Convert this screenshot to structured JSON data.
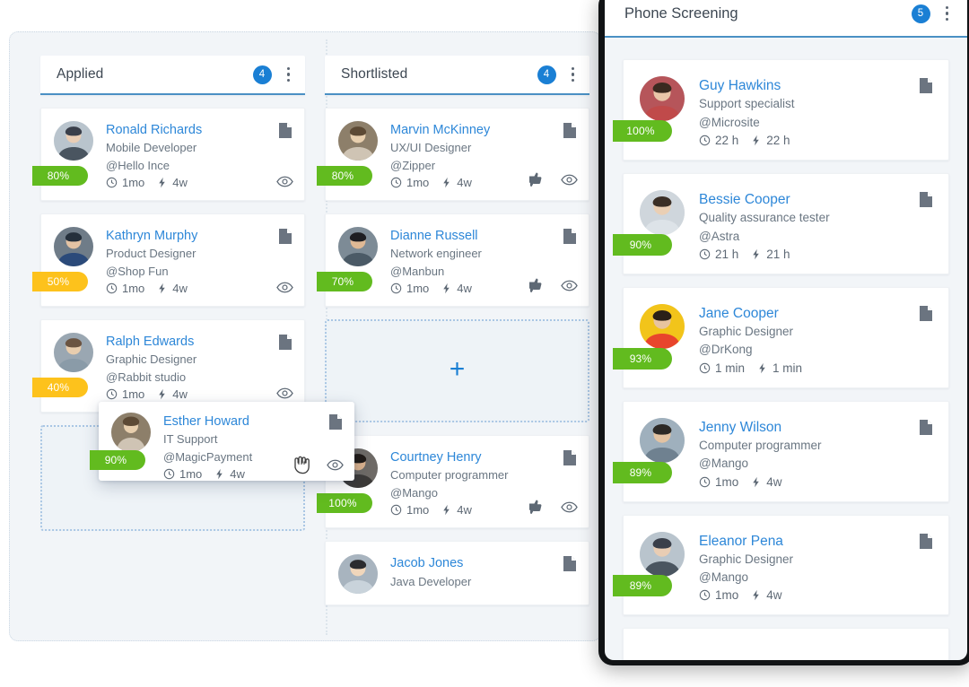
{
  "board": {
    "columns": [
      {
        "title": "Applied",
        "count": "4",
        "cards": [
          {
            "name": "Ronald Richards",
            "role": "Mobile Developer",
            "company": "@Hello Ince",
            "time": "1mo",
            "bolt": "4w",
            "pct": "80%",
            "pct_color": "#62bb1f",
            "actions": [
              "eye-icon"
            ]
          },
          {
            "name": "Kathryn Murphy",
            "role": "Product Designer",
            "company": "@Shop Fun",
            "time": "1mo",
            "bolt": "4w",
            "pct": "50%",
            "pct_color": "#fdc21c",
            "actions": [
              "eye-icon"
            ]
          },
          {
            "name": "Ralph Edwards",
            "role": "Graphic Designer",
            "company": "@Rabbit studio",
            "time": "1mo",
            "bolt": "4w",
            "pct": "40%",
            "pct_color": "#fdc21c",
            "actions": [
              "eye-icon"
            ]
          }
        ],
        "dropzone": {
          "show": true,
          "plus": ""
        }
      },
      {
        "title": "Shortlisted",
        "count": "4",
        "cards": [
          {
            "name": "Marvin McKinney",
            "role": "UX/UI Designer",
            "company": "@Zipper",
            "time": "1mo",
            "bolt": "4w",
            "pct": "80%",
            "pct_color": "#62bb1f",
            "actions": [
              "thumbs-icon",
              "eye-icon"
            ]
          },
          {
            "name": "Dianne Russell",
            "role": "Network engineer",
            "company": "@Manbun",
            "time": "1mo",
            "bolt": "4w",
            "pct": "70%",
            "pct_color": "#62bb1f",
            "actions": [
              "thumbs-icon",
              "eye-icon"
            ]
          }
        ],
        "dropzone": {
          "show": true,
          "plus": "+"
        },
        "cards_after": [
          {
            "name": "Courtney Henry",
            "role": "Computer programmer",
            "company": "@Mango",
            "time": "1mo",
            "bolt": "4w",
            "pct": "100%",
            "pct_color": "#62bb1f",
            "actions": [
              "thumbs-icon",
              "eye-icon"
            ]
          },
          {
            "name": "Jacob Jones",
            "role": "Java Developer",
            "company": "",
            "time": "",
            "bolt": "",
            "pct": "",
            "pct_color": "",
            "actions": []
          }
        ]
      }
    ]
  },
  "drag_card": {
    "name": "Esther Howard",
    "role": "IT Support",
    "company": "@MagicPayment",
    "time": "1mo",
    "bolt": "4w",
    "pct": "90%",
    "pct_color": "#62bb1f",
    "cursor": "grab-hand-cursor"
  },
  "phone_screening": {
    "title": "Phone Screening",
    "count": "5",
    "cards": [
      {
        "name": "Guy Hawkins",
        "role": "Support specialist",
        "company": "@Microsite",
        "time": "22 h",
        "bolt": "22 h",
        "pct": "100%",
        "pct_color": "#62bb1f"
      },
      {
        "name": "Bessie Cooper",
        "role": "Quality assurance tester",
        "company": "@Astra",
        "time": "21 h",
        "bolt": "21 h",
        "pct": "90%",
        "pct_color": "#62bb1f"
      },
      {
        "name": "Jane Cooper",
        "role": "Graphic Designer",
        "company": "@DrKong",
        "time": "1 min",
        "bolt": "1 min",
        "pct": "93%",
        "pct_color": "#62bb1f"
      },
      {
        "name": "Jenny Wilson",
        "role": "Computer programmer",
        "company": "@Mango",
        "time": "1mo",
        "bolt": "4w",
        "pct": "89%",
        "pct_color": "#62bb1f"
      },
      {
        "name": "Eleanor Pena",
        "role": "Graphic Designer",
        "company": "@Mango",
        "time": "1mo",
        "bolt": "4w",
        "pct": "89%",
        "pct_color": "#62bb1f"
      }
    ]
  },
  "colors": {
    "accent_blue": "#1a7fd4",
    "name_blue": "#2d87d8",
    "green": "#62bb1f",
    "yellow": "#fdc21c",
    "board_bg": "#f2f5f8",
    "header_underline": "#4a90c4"
  },
  "icons": {
    "doc": "document-icon",
    "eye": "eye-icon",
    "thumbs": "thumbs-up-down-icon",
    "clock": "clock-icon",
    "bolt": "bolt-icon",
    "kebab": "kebab-menu-icon"
  }
}
